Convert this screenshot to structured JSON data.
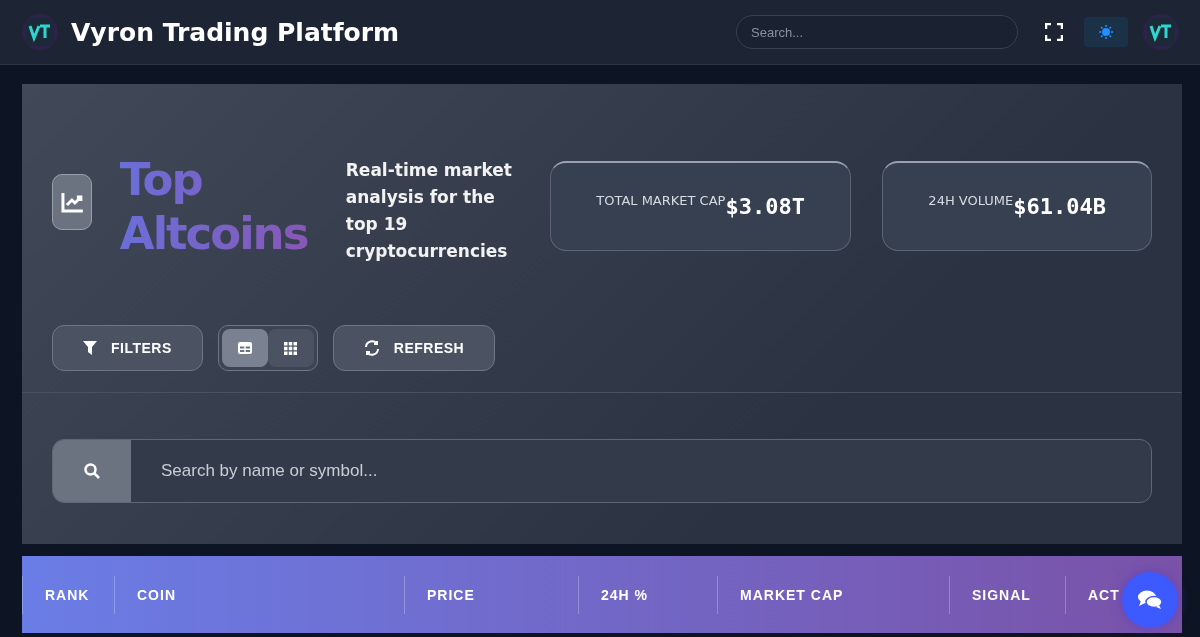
{
  "header": {
    "title": "Vyron Trading Platform",
    "search": {
      "placeholder": "Search..."
    }
  },
  "hero": {
    "title_lines": [
      "Top",
      "Altcoins"
    ],
    "description": "Real-time market analysis for the top 19 cryptocurrencies",
    "stats": [
      {
        "label": "TOTAL MARKET CAP",
        "value": "$3.08T"
      },
      {
        "label": "24H VOLUME",
        "value": "$61.04B"
      }
    ],
    "filters_button": "FILTERS",
    "view_toggle": [
      {
        "kind": "table",
        "selected": true
      },
      {
        "kind": "grid",
        "selected": false
      }
    ],
    "refresh_button": "REFRESH"
  },
  "search": {
    "placeholder": "Search by name or symbol..."
  },
  "table": {
    "columns": [
      "RANK",
      "COIN",
      "PRICE",
      "24H %",
      "MARKET CAP",
      "SIGNAL",
      "ACT"
    ]
  }
}
